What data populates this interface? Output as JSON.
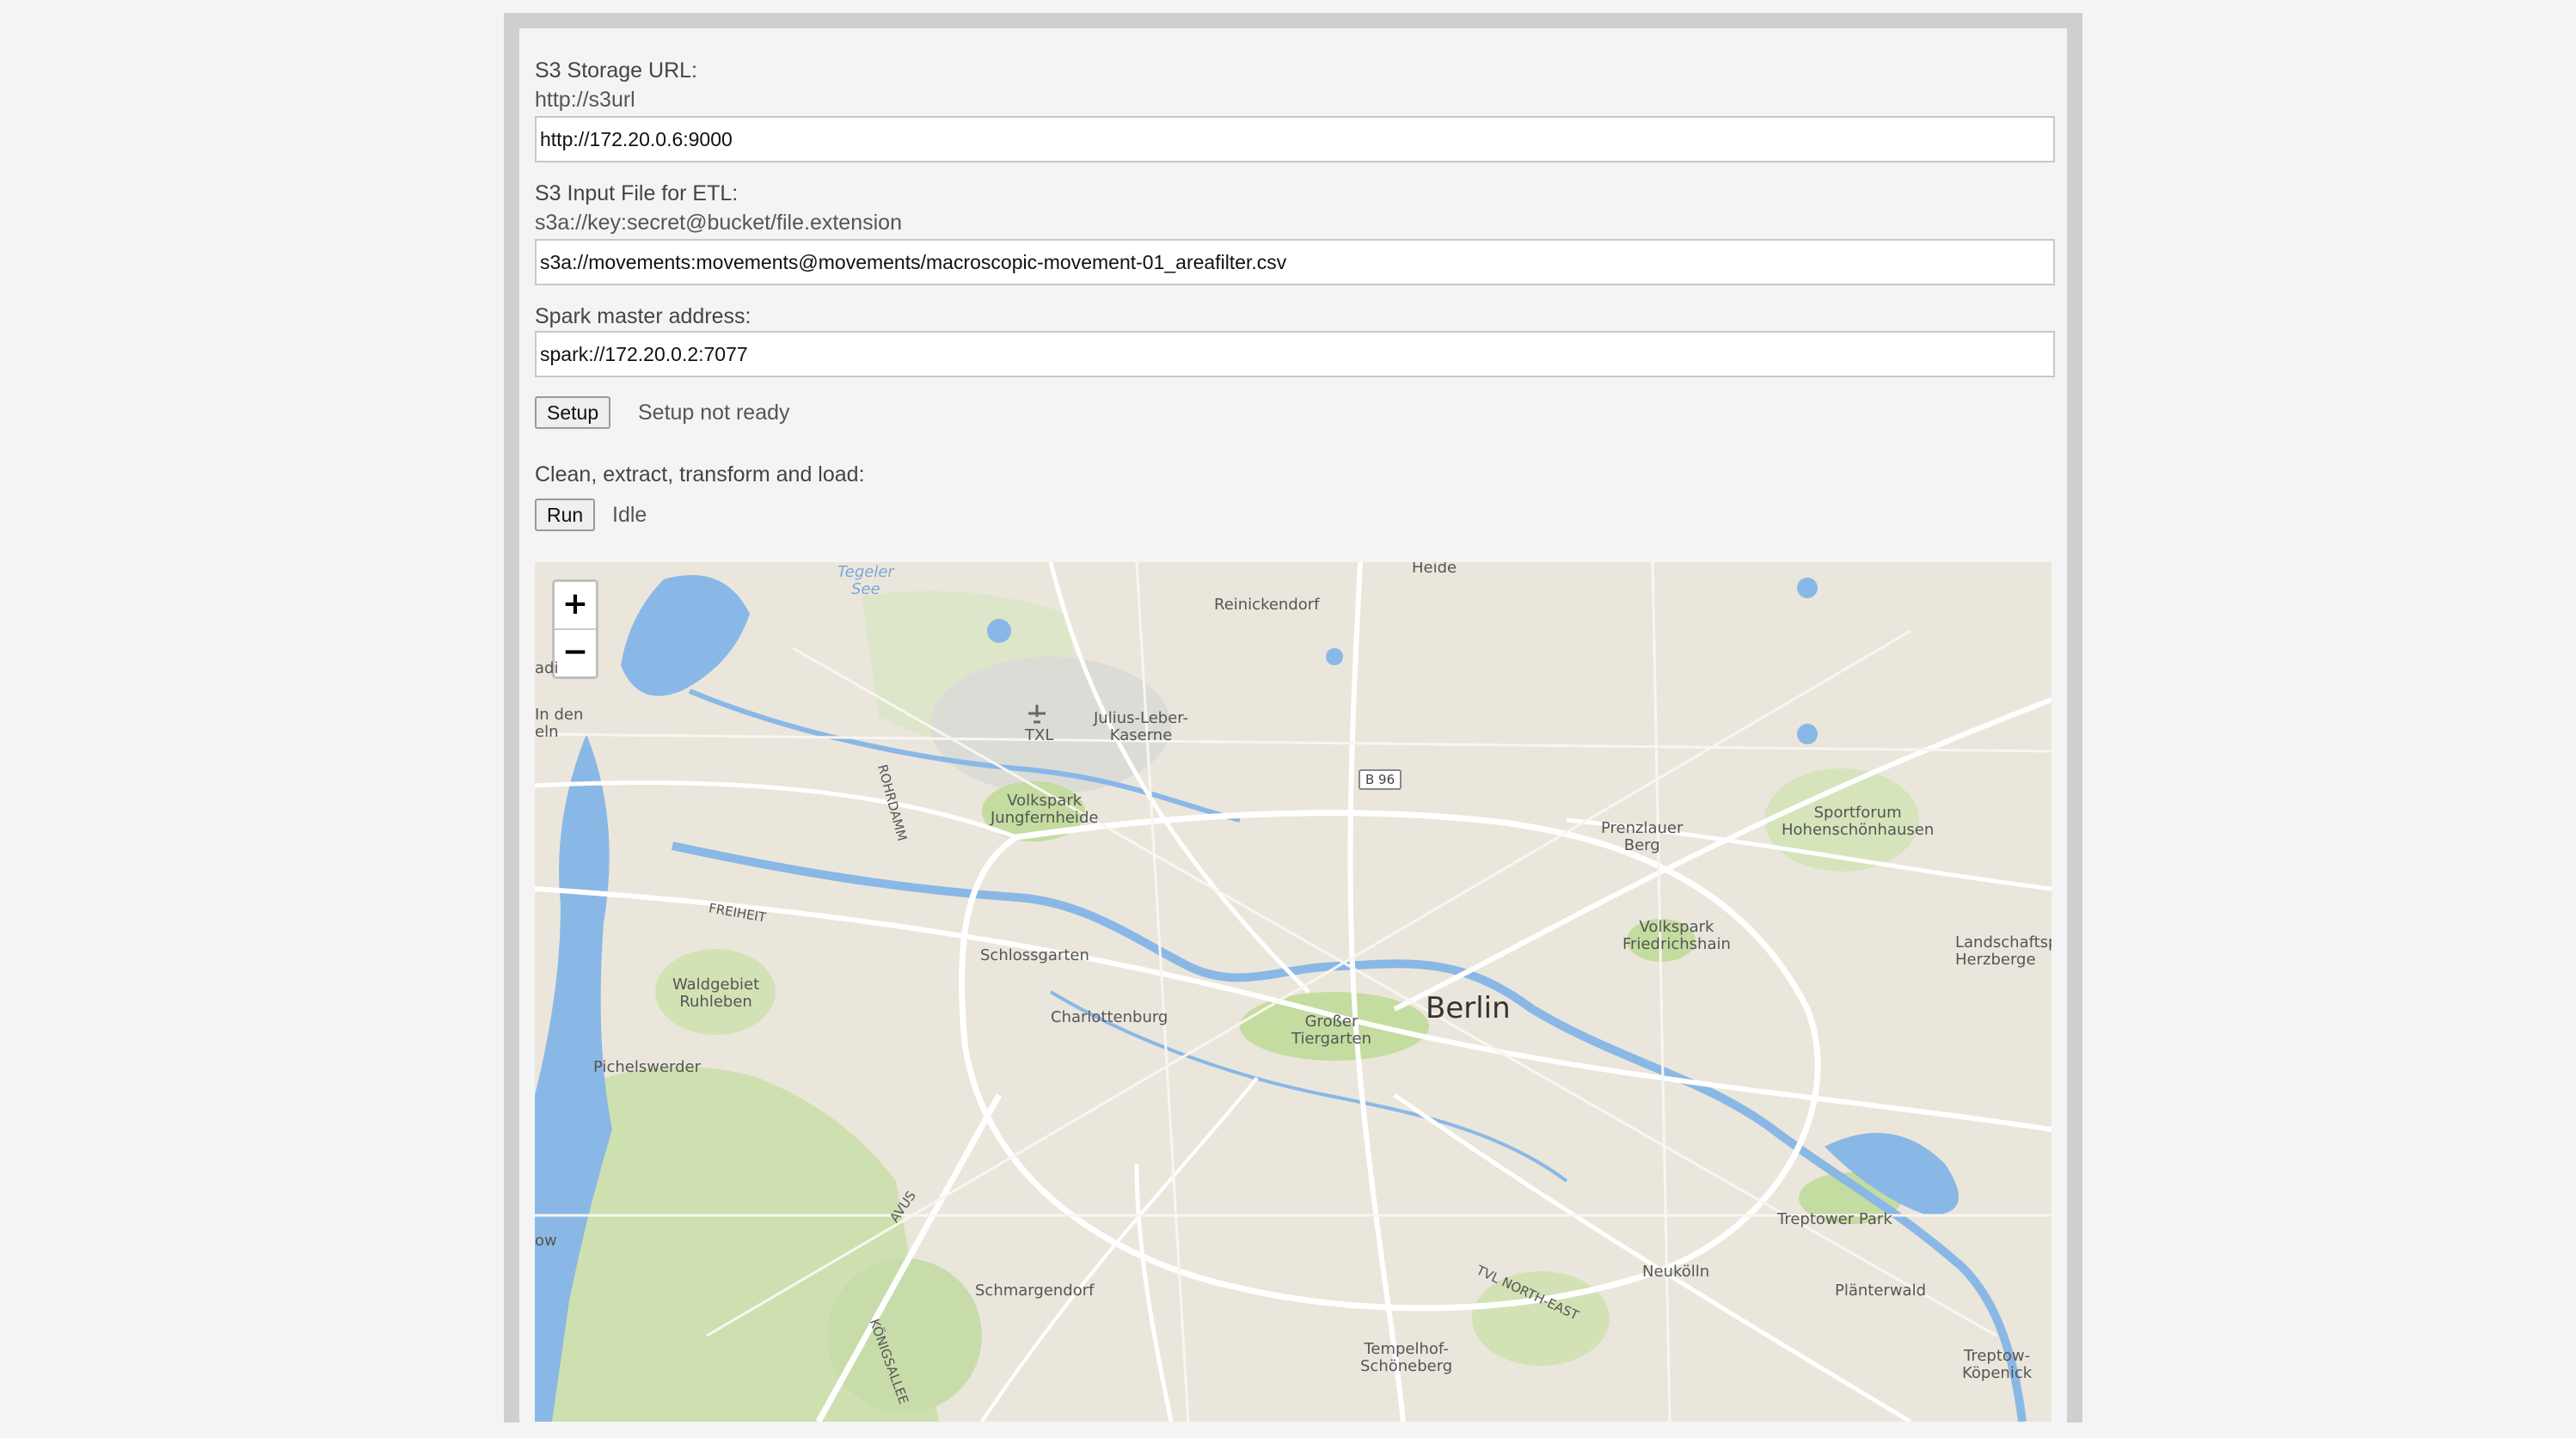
{
  "s3_url": {
    "label": "S3 Storage URL:",
    "hint": "http://s3url",
    "value": "http://172.20.0.6:9000"
  },
  "s3_input": {
    "label": "S3 Input File for ETL:",
    "hint": "s3a://key:secret@bucket/file.extension",
    "value": "s3a://movements:movements@movements/macroscopic-movement-01_areafilter.csv"
  },
  "spark": {
    "label": "Spark master address:",
    "value": "spark://172.20.0.2:7077"
  },
  "setup": {
    "button_label": "Setup",
    "status": "Setup not ready"
  },
  "etl": {
    "label": "Clean, extract, transform and load:",
    "button_label": "Run",
    "status": "Idle"
  },
  "map": {
    "zoom_in": "+",
    "zoom_out": "−",
    "city": "Berlin",
    "labels": {
      "heide": "Heide",
      "reinickendorf": "Reinickendorf",
      "tegeler_see": "Tegeler\nSee",
      "txl": "TXL",
      "julius_leber": "Julius-Leber-\nKaserne",
      "b96": "B 96",
      "in_den": "In den\neln",
      "volkspark_jungfernheide": "Volkspark\nJungfernheide",
      "rohrdamm": "ROHRDAMM",
      "freiheit": "FREIHEIT",
      "prenzlauer": "Prenzlauer\nBerg",
      "sportforum": "Sportforum\nHohenschönhausen",
      "schlossgarten": "Schlossgarten",
      "volkspark_friedrichshain": "Volkspark\nFriedrichshain",
      "landschaftspark": "Landschaftsp\nHerzberge",
      "waldgebiet": "Waldgebiet\nRuhleben",
      "charlottenburg": "Charlottenburg",
      "tiergarten": "Großer\nTiergarten",
      "pichelswerder": "Pichelswerder",
      "avus": "AVUS",
      "treptower_park": "Treptower Park",
      "neukolln": "Neukölln",
      "plänterwald": "Plänterwald",
      "schmargendorf": "Schmargendorf",
      "tempelhof": "Tempelhof-\nSchöneberg",
      "tvl_north_east": "TVL NORTH-EAST",
      "treptow_kopenick": "Treptow-\nKöpenick",
      "ow": "ow",
      "adi": "adi",
      "konigsallee": "KÖNIGSALLEE"
    }
  }
}
